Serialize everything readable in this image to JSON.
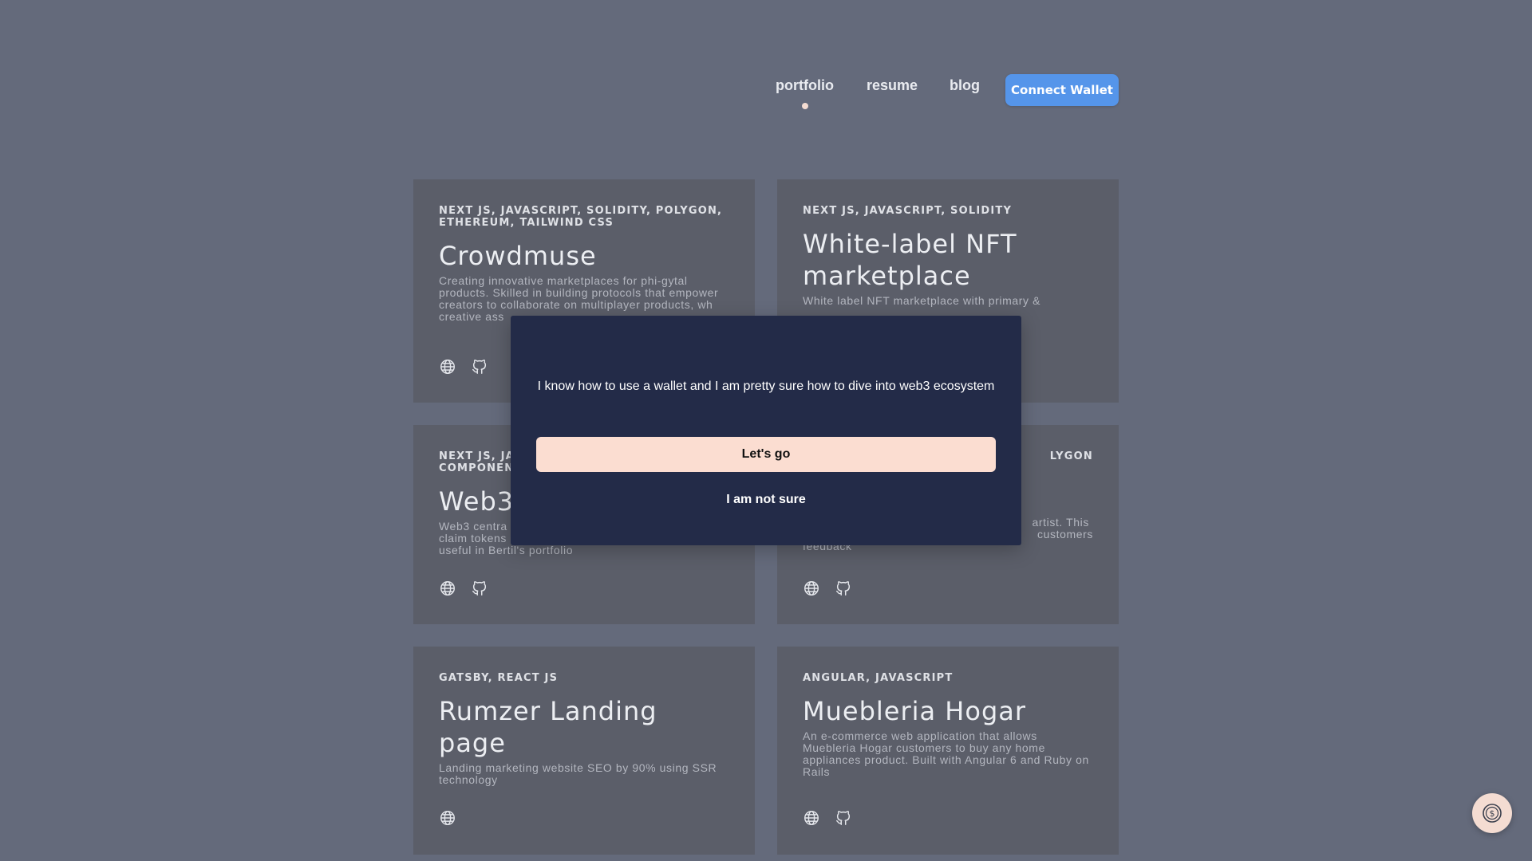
{
  "nav": {
    "links": [
      {
        "label": "portfolio",
        "active": true
      },
      {
        "label": "resume",
        "active": false
      },
      {
        "label": "blog",
        "active": false
      }
    ],
    "connect_label": "Connect Wallet",
    "connect_color": "#5595ea"
  },
  "projects": [
    {
      "tags": "NEXT JS, JAVASCRIPT, SOLIDITY, POLYGON, ETHEREUM, TAILWIND CSS",
      "title": "Crowdmuse",
      "description": "Creating innovative marketplaces for phi-gytal products. Skilled in building protocols that empower creators to collaborate on multiplayer products, wh",
      "description_tail": "creative ass",
      "icons": [
        "globe-icon",
        "github-icon"
      ]
    },
    {
      "tags": "NEXT JS, JAVASCRIPT, SOLIDITY",
      "title": "White-label NFT marketplace",
      "description": "White label NFT marketplace with primary &",
      "icons": []
    },
    {
      "tags": "NEXT JS, JAV",
      "tags_line2": "COMPONENT",
      "title": "Web3",
      "description": "Web3 centra",
      "description_line2": "claim tokens and buy NFT. These tokens are",
      "description_line3": "useful in Bertil's portfolio",
      "icons": [
        "globe-icon",
        "github-icon"
      ]
    },
    {
      "tags": "LYGON",
      "title": "",
      "description": "artist. This",
      "description_line2": "customers",
      "description_line3": "feedback",
      "icons": [
        "globe-icon",
        "github-icon"
      ]
    },
    {
      "tags": "GATSBY, REACT JS",
      "title": "Rumzer Landing page",
      "description": "Landing marketing website SEO by 90% using SSR technology",
      "icons": [
        "globe-icon"
      ]
    },
    {
      "tags": "ANGULAR, JAVASCRIPT",
      "title": "Muebleria Hogar",
      "description": "An e-commerce web application that allows Muebleria Hogar customers to buy any home appliances product. Built with Angular 6 and Ruby on Rails",
      "icons": [
        "globe-icon",
        "github-icon"
      ]
    }
  ],
  "modal": {
    "message": "I know how to use a wallet and I am pretty sure how to dive into web3 ecosystem",
    "primary_label": "Let's go",
    "secondary_label": "I am not sure"
  },
  "fab": {
    "icon": "dollar-coin-icon"
  }
}
